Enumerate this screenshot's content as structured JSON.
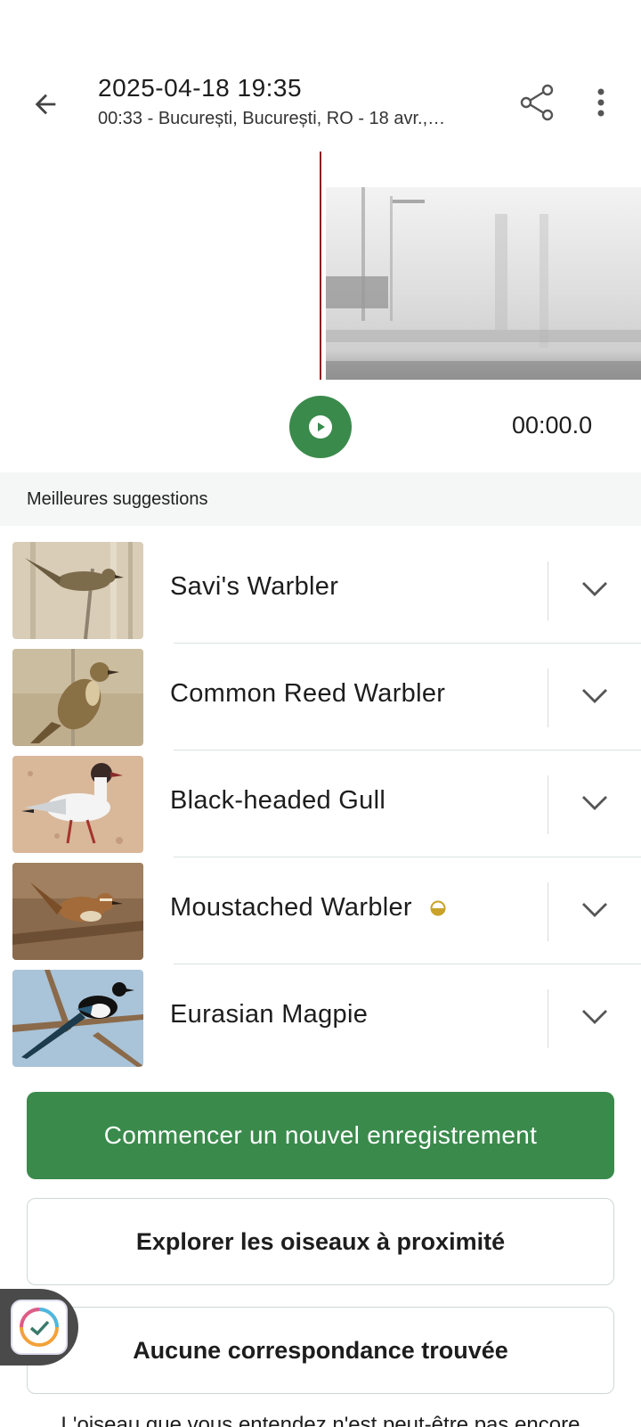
{
  "header": {
    "title": "2025-04-18 19:35",
    "subtitle": "00:33 - București, București, RO - 18 avr.,…"
  },
  "player": {
    "time": "00:00.0"
  },
  "section": {
    "title": "Meilleures suggestions"
  },
  "suggestions": [
    {
      "name": "Savi's Warbler",
      "image": "savis-warbler-photo"
    },
    {
      "name": "Common Reed Warbler",
      "image": "common-reed-warbler-photo"
    },
    {
      "name": "Black-headed Gull",
      "image": "black-headed-gull-photo"
    },
    {
      "name": "Moustached Warbler",
      "image": "moustached-warbler-photo",
      "badge": "half-circle-icon"
    },
    {
      "name": "Eurasian Magpie",
      "image": "eurasian-magpie-photo"
    }
  ],
  "buttons": {
    "new_recording": "Commencer un nouvel enregistrement",
    "explore": "Explorer les oiseaux à proximité",
    "no_match": "Aucune correspondance trouvée"
  },
  "footer": {
    "text": "L'oiseau que vous entendez n'est peut-être pas encore"
  },
  "colors": {
    "accent": "#3a8a4c",
    "playhead": "#8a1f1f",
    "badge": "#c9a227"
  }
}
